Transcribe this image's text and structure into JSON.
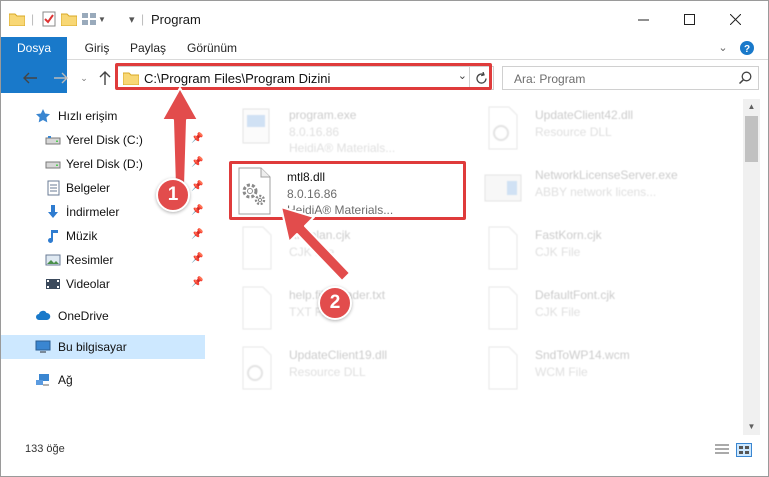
{
  "window": {
    "title": "Program"
  },
  "ribbon": {
    "tabs": [
      "Dosya",
      "Giriş",
      "Paylaş",
      "Görünüm"
    ]
  },
  "address": {
    "path": "C:\\Program Files\\Program Dizini"
  },
  "search": {
    "placeholder": "Ara: Program"
  },
  "sidebar": {
    "items": [
      {
        "label": "Hızlı erişim",
        "icon": "star-icon"
      },
      {
        "label": "Yerel Disk (C:)",
        "icon": "drive-icon",
        "pinned": true
      },
      {
        "label": "Yerel Disk (D:)",
        "icon": "drive-icon",
        "pinned": true
      },
      {
        "label": "Belgeler",
        "icon": "documents-icon",
        "pinned": true
      },
      {
        "label": "İndirmeler",
        "icon": "download-icon",
        "pinned": true
      },
      {
        "label": "Müzik",
        "icon": "music-icon",
        "pinned": true
      },
      {
        "label": "Resimler",
        "icon": "pictures-icon",
        "pinned": true
      },
      {
        "label": "Videolar",
        "icon": "videos-icon",
        "pinned": true
      },
      {
        "label": "OneDrive",
        "icon": "cloud-icon"
      },
      {
        "label": "Bu bilgisayar",
        "icon": "computer-icon",
        "selected": true
      },
      {
        "label": "Ağ",
        "icon": "network-icon"
      }
    ]
  },
  "files": [
    {
      "name": "program.exe",
      "line1": "8.0.16.86",
      "line2": "HeidiA® Materials...",
      "faded": true
    },
    {
      "name": "UpdateClient42.dll",
      "line1": "Resource DLL",
      "line2": "",
      "faded": true
    },
    {
      "name": "mtl8.dll",
      "line1": "8.0.16.86",
      "line2": "HeidiA® Materials...",
      "faded": false
    },
    {
      "name": "NetworkLicenseServer.exe",
      "line1": "ABBY network licens...",
      "line2": "",
      "faded": true
    },
    {
      "name": "Kitaplan.cjk",
      "line1": "CJK File",
      "line2": "",
      "faded": true
    },
    {
      "name": "FastKorn.cjk",
      "line1": "CJK File",
      "line2": "",
      "faded": true
    },
    {
      "name": "help.fileReader.txt",
      "line1": "TXT File",
      "line2": "",
      "faded": true
    },
    {
      "name": "DefaultFont.cjk",
      "line1": "CJK File",
      "line2": "",
      "faded": true
    },
    {
      "name": "UpdateClient19.dll",
      "line1": "Resource DLL",
      "line2": "",
      "faded": true
    },
    {
      "name": "SndToWP14.wcm",
      "line1": "WCM File",
      "line2": "",
      "faded": true
    }
  ],
  "status": {
    "item_count": "133 öğe"
  },
  "annotations": {
    "badge1": "1",
    "badge2": "2",
    "color": "#df3b3b"
  },
  "colors": {
    "accent": "#1979ca",
    "selected_bg": "#cde8ff"
  }
}
